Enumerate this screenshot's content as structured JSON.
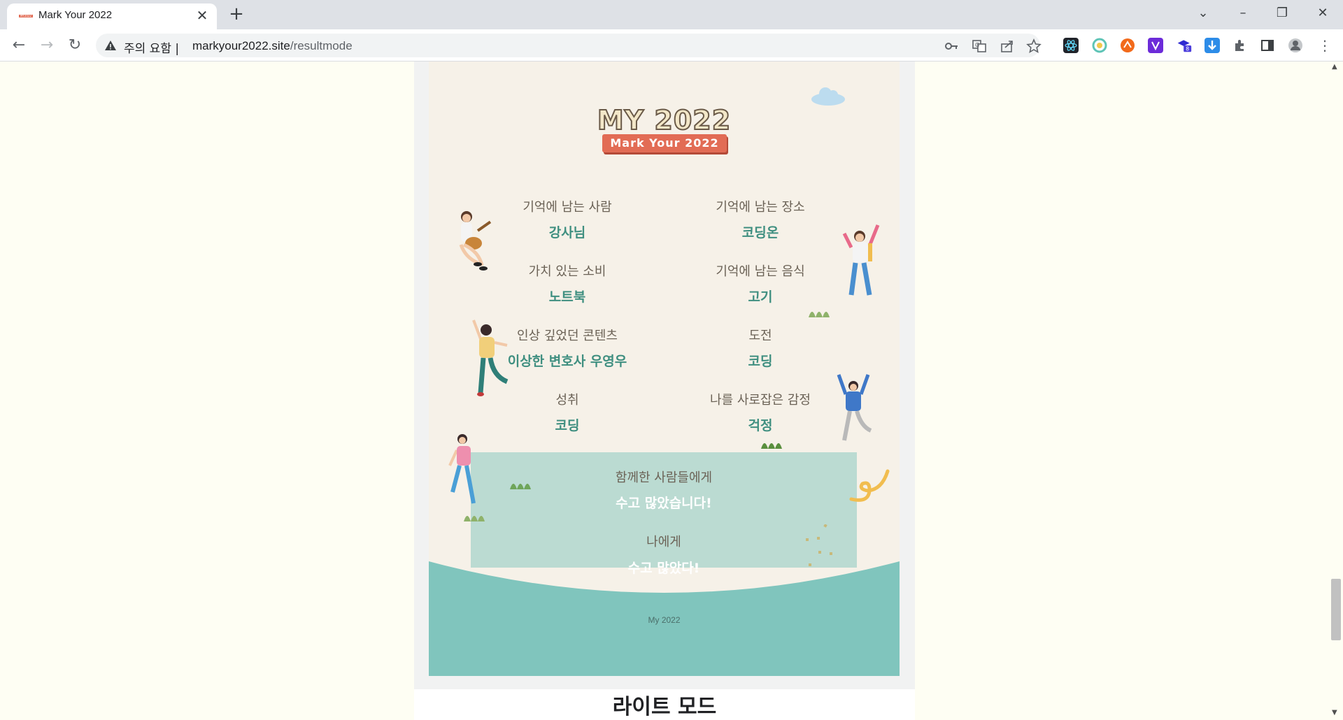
{
  "browser": {
    "tab_title": "Mark Your 2022",
    "new_tab": "+",
    "warning_label": "주의 요함",
    "separator": "|",
    "url_host": "markyour2022.site",
    "url_path": "/resultmode",
    "extension_badge": "8"
  },
  "card": {
    "title": "MY 2022",
    "ribbon": "Mark Your 2022",
    "items": [
      {
        "question": "기억에 남는 사람",
        "answer": "강사님"
      },
      {
        "question": "기억에 남는 장소",
        "answer": "코딩온"
      },
      {
        "question": "가치 있는 소비",
        "answer": "노트북"
      },
      {
        "question": "기억에 남는 음식",
        "answer": "고기"
      },
      {
        "question": "인상 깊었던 콘텐츠",
        "answer": "이상한 변호사 우영우"
      },
      {
        "question": "도전",
        "answer": "코딩"
      },
      {
        "question": "성취",
        "answer": "코딩"
      },
      {
        "question": "나를 사로잡은 감정",
        "answer": "걱정"
      }
    ],
    "thanks": [
      {
        "question": "함께한 사람들에게",
        "answer": "수고 많았습니다!"
      },
      {
        "question": "나에게",
        "answer": "수고 많았다!"
      }
    ],
    "footer": "My 2022"
  },
  "section_heading": "라이트 모드",
  "colors": {
    "page_bg": "#fefef3",
    "card_bg": "#f6f1e8",
    "answer": "#3f8f80",
    "ground": "#80c5bd",
    "thanks_box": "#bbdbd2",
    "ribbon": "#e26c55"
  }
}
